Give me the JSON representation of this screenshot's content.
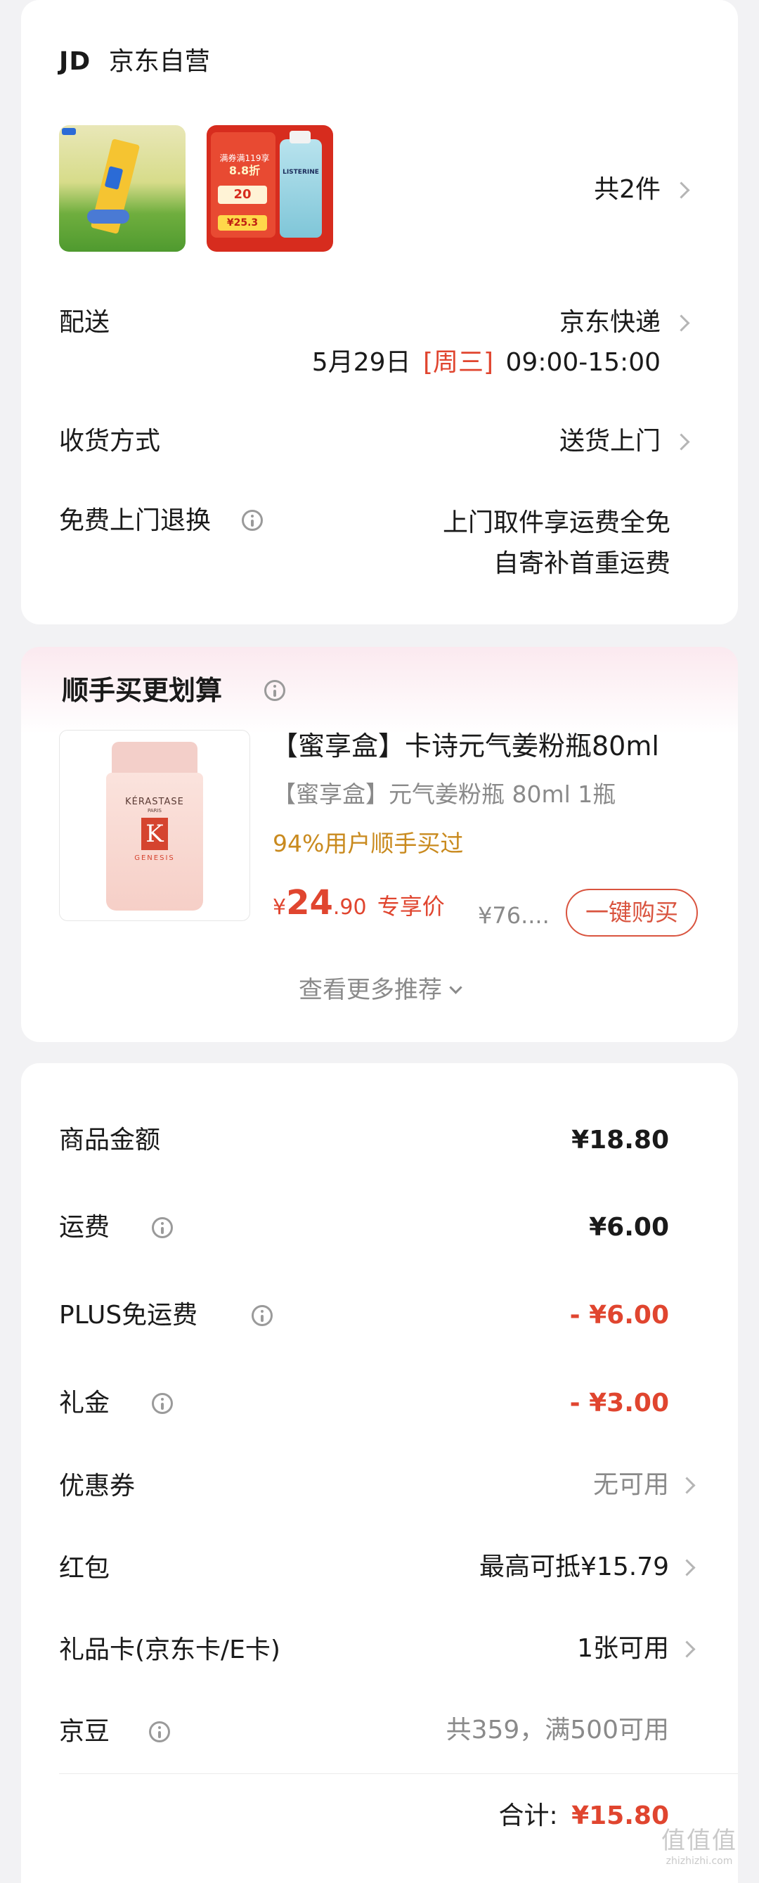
{
  "store": {
    "logo": "JD",
    "name": "京东自营",
    "item_count": "共2件"
  },
  "thumbs": {
    "left": {
      "name": "product-thumb-milk"
    },
    "right": {
      "badge1": "满券满119享",
      "badge2": "8.8折",
      "coupon": "20",
      "brand": "LISTERINE",
      "price": "¥25.3"
    }
  },
  "delivery": {
    "label": "配送",
    "carrier": "京东快递",
    "date": "5月29日",
    "weekday": "[周三]",
    "time": "09:00-15:00"
  },
  "receive": {
    "label": "收货方式",
    "value": "送货上门"
  },
  "returns": {
    "label": "免费上门退换",
    "line1": "上门取件享运费全免",
    "line2": "自寄补首重运费"
  },
  "recommend": {
    "title": "顺手买更划算",
    "product_title": "【蜜享盒】卡诗元气姜粉瓶80ml",
    "spec": "【蜜享盒】元气姜粉瓶 80ml 1瓶",
    "stat": "94%用户顺手买过",
    "price_symbol": "¥",
    "price_int": "24",
    "price_dec": ".90",
    "price_tag": "专享价",
    "orig_price": "¥76....",
    "buy_btn": "一键购买",
    "more": "查看更多推荐",
    "bottle_brand": "KÉRASTASE",
    "bottle_sub": "PARIS",
    "bottle_letter": "K",
    "bottle_line": "GENESIS"
  },
  "summary": {
    "rows": [
      {
        "label": "商品金额",
        "value": "¥18.80"
      },
      {
        "label": "运费",
        "value": "¥6.00"
      },
      {
        "label": "PLUS免运费",
        "value": "- ¥6.00"
      },
      {
        "label": "礼金",
        "value": "- ¥3.00"
      },
      {
        "label": "优惠券",
        "value": "无可用"
      },
      {
        "label": "红包",
        "value": "最高可抵¥15.79"
      },
      {
        "label": "礼品卡(京东卡/E卡)",
        "value": "1张可用"
      },
      {
        "label": "京豆",
        "value": "共359，满500可用"
      }
    ],
    "total_label": "合计:",
    "total_value": "¥15.80"
  },
  "watermark": {
    "text": "值值值",
    "url": "zhizhizhi.com"
  },
  "colors": {
    "accent_red": "#e0452f",
    "muted": "#8a8a8a",
    "orange": "#c98a1e"
  }
}
